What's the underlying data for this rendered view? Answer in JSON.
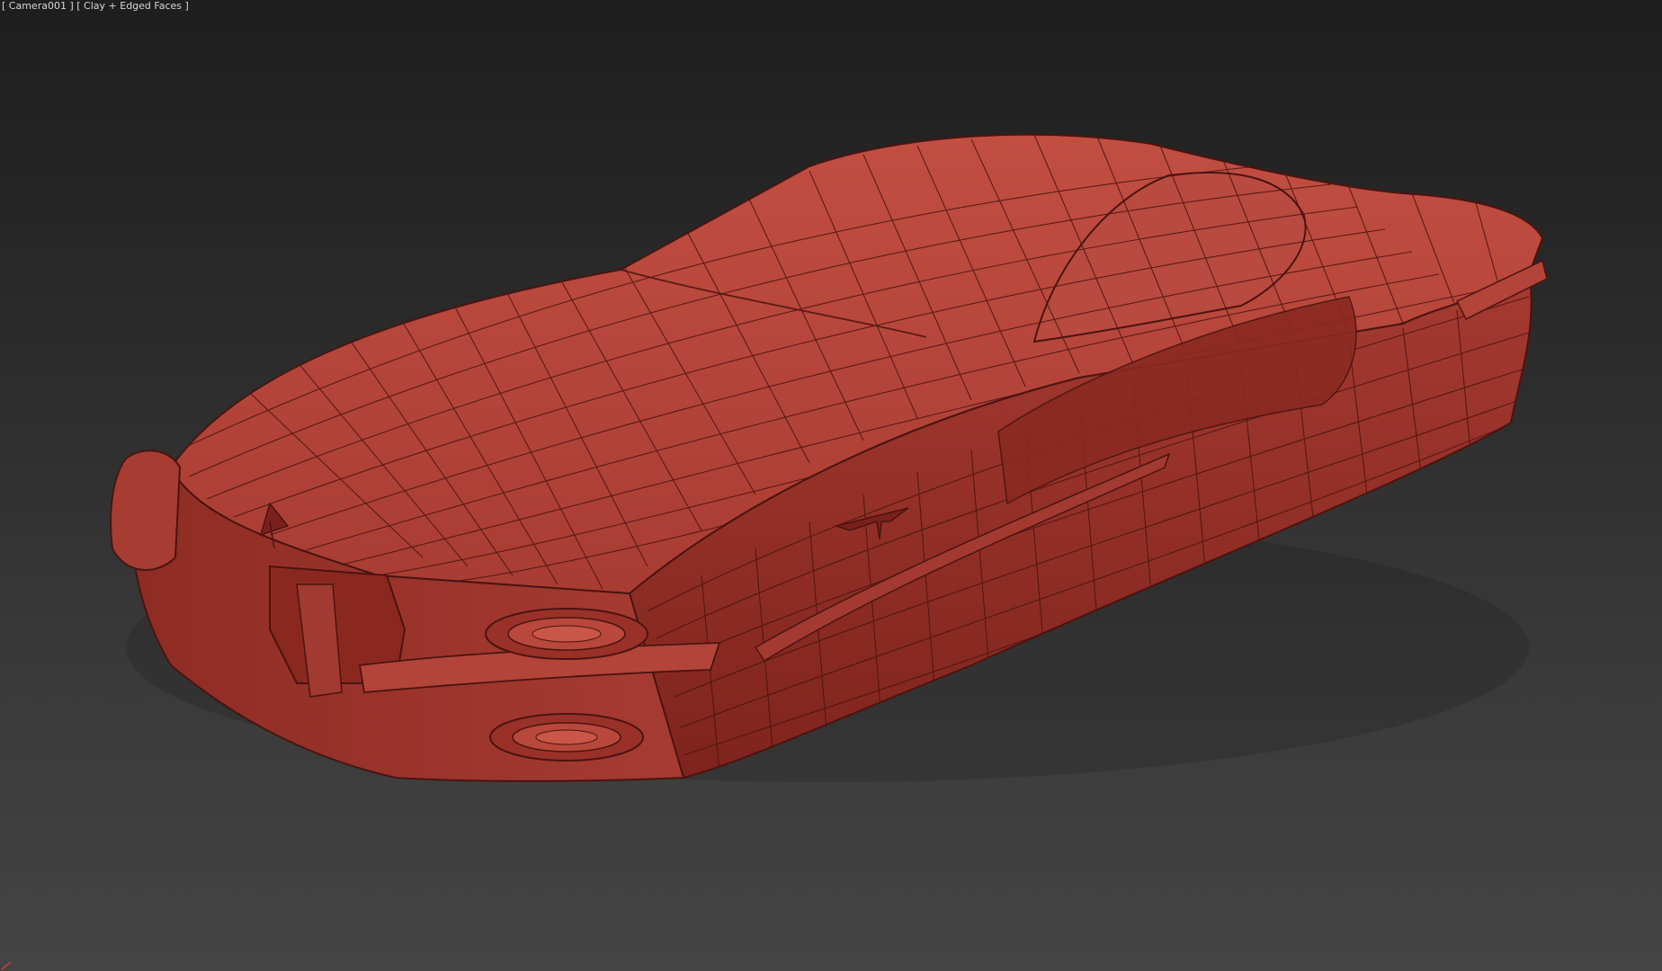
{
  "viewport": {
    "camera_label": "Camera001",
    "shading_label": "Clay + Edged Faces",
    "model": {
      "fill_color": "#b8443a",
      "fill_dark": "#8a2820",
      "fill_light": "#cc5546",
      "wire_color": "#4a1410"
    },
    "gizmo_color": "#d23a3a"
  }
}
